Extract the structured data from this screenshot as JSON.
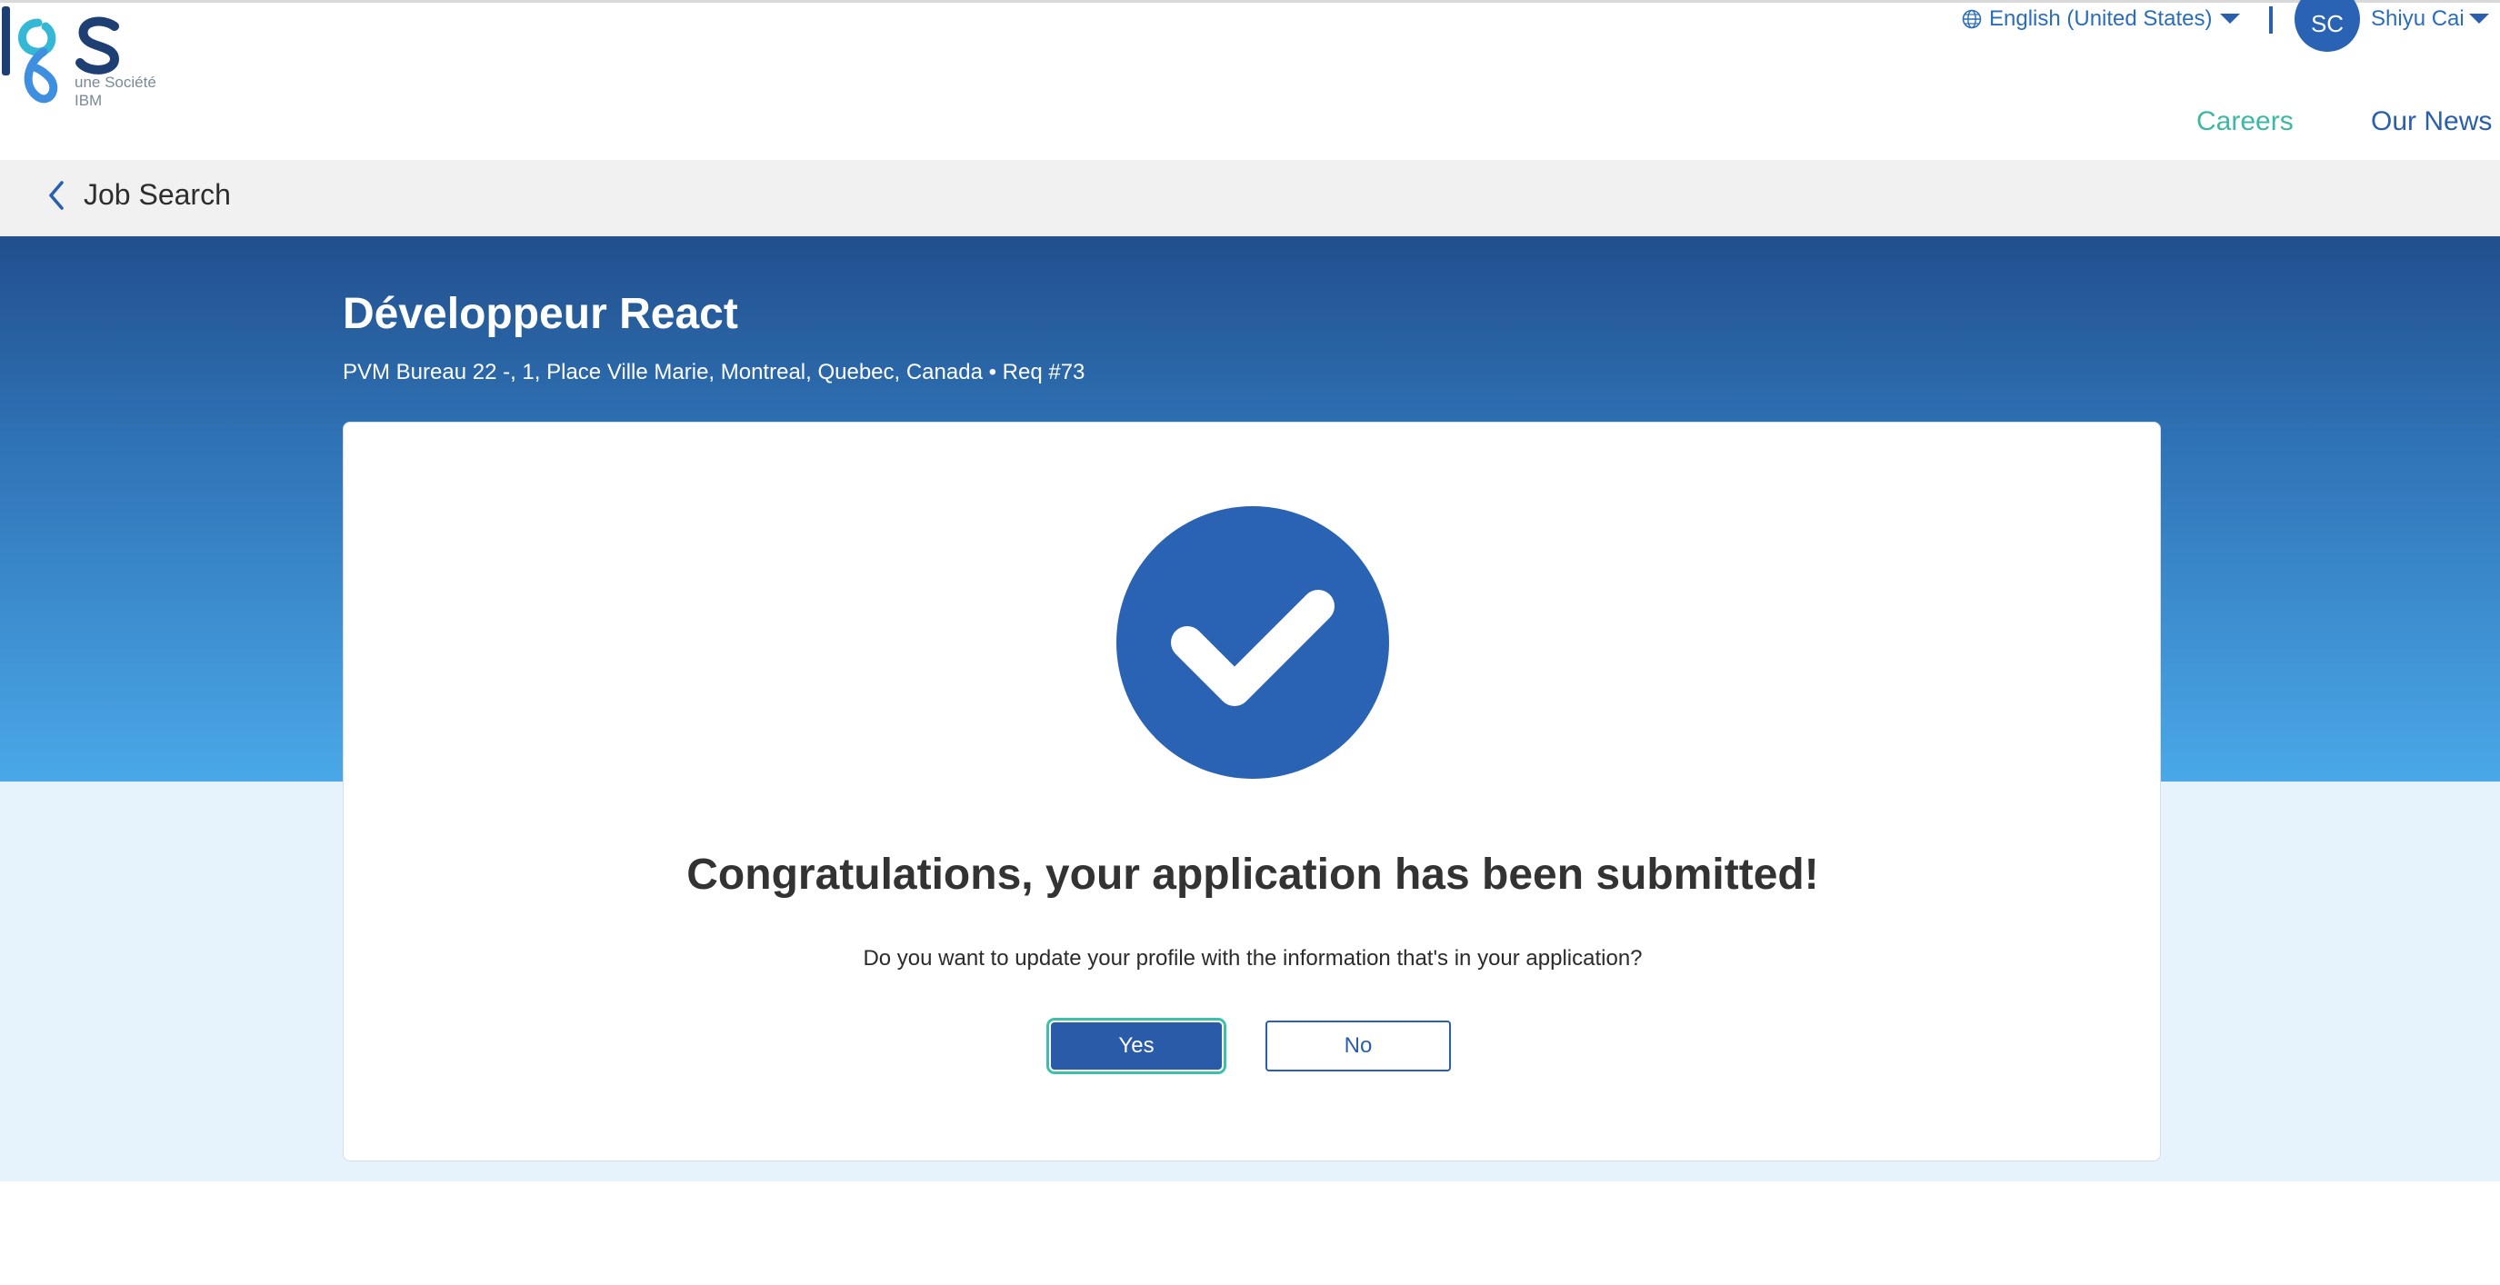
{
  "header": {
    "logo_text": "lgs",
    "logo_tagline": "une Société IBM",
    "language": "English (United States)",
    "user_initials": "SC",
    "user_name": "Shiyu Cai",
    "nav": {
      "careers": "Careers",
      "news": "Our News"
    }
  },
  "breadcrumb": {
    "back_label": "Job Search"
  },
  "job": {
    "title": "Développeur React",
    "subtitle": "PVM Bureau 22 -, 1, Place Ville Marie, Montreal, Quebec, Canada • Req #73"
  },
  "confirmation": {
    "headline": "Congratulations, your application has been submitted!",
    "question": "Do you want to update your profile with the information that's in your application?",
    "yes_label": "Yes",
    "no_label": "No"
  },
  "colors": {
    "brand_blue": "#2a5fae",
    "accent_teal": "#3cb8a4",
    "hero_top": "#224f8d",
    "hero_bottom": "#4aa8e8",
    "check_circle": "#2a62b4"
  },
  "icons": [
    "globe-icon",
    "chevron-down-icon",
    "chevron-left-icon",
    "check-circle-icon"
  ]
}
